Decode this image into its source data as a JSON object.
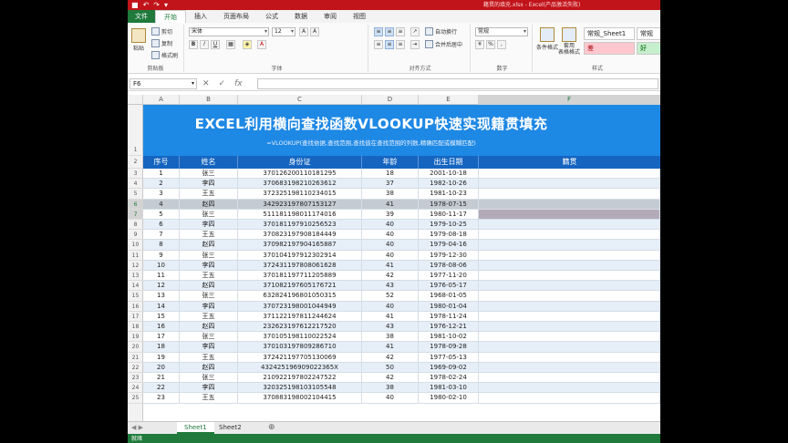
{
  "titlebar": {
    "title": "籍贯的填充.xlsx - Excel(产品激活失败)",
    "qat": [
      "■",
      "↶",
      "↷",
      "▾"
    ]
  },
  "tabs": [
    "文件",
    "开始",
    "插入",
    "页面布局",
    "公式",
    "数据",
    "审阅",
    "视图"
  ],
  "ribbon": {
    "clipboard": {
      "paste": "粘贴",
      "cut": "剪切",
      "copy": "复制",
      "format_painter": "格式刷",
      "label": "剪贴板"
    },
    "font": {
      "name": "宋体",
      "size": "12",
      "bold": "B",
      "italic": "I",
      "underline": "U",
      "grow": "A",
      "shrink": "A",
      "color": "A",
      "label": "字体"
    },
    "alignment": {
      "wrap": "自动换行",
      "merge": "合并后居中",
      "label": "对齐方式"
    },
    "number": {
      "format": "常规",
      "percent": "%",
      "comma": ",",
      "label": "数字"
    },
    "styles": {
      "conditional": "条件格式",
      "table": "套用\n表格格式",
      "style_normal_sheet": "常规_Sheet1",
      "style_normal": "常规",
      "style_bad": "差",
      "style_good": "好",
      "label": "样式"
    }
  },
  "formula_bar": {
    "namebox": "F6",
    "cancel": "✕",
    "enter": "✓",
    "fx": "fx"
  },
  "columns": [
    "A",
    "B",
    "C",
    "D",
    "E",
    "F"
  ],
  "banner": {
    "title": "EXCEL利用横向查找函数VLOOKUP快速实现籍贯填充",
    "subtitle": "=VLOOKUP(查找依据,查找范围,查找值在查找范围的列数,精确匹配或模糊匹配)"
  },
  "table": {
    "headers": [
      "序号",
      "姓名",
      "身份证",
      "年龄",
      "出生日期",
      "籍贯"
    ],
    "rows": [
      [
        "1",
        "张三",
        "370126200110181295",
        "18",
        "2001-10-18"
      ],
      [
        "2",
        "李四",
        "370683198210263612",
        "37",
        "1982-10-26"
      ],
      [
        "3",
        "王五",
        "372325198110234015",
        "38",
        "1981-10-23"
      ],
      [
        "4",
        "赵四",
        "342923197807153127",
        "41",
        "1978-07-15"
      ],
      [
        "5",
        "张三",
        "511181198011174016",
        "39",
        "1980-11-17"
      ],
      [
        "6",
        "李四",
        "370181197910256523",
        "40",
        "1979-10-25"
      ],
      [
        "7",
        "王五",
        "370823197908184449",
        "40",
        "1979-08-18"
      ],
      [
        "8",
        "赵四",
        "370982197904165887",
        "40",
        "1979-04-16"
      ],
      [
        "9",
        "张三",
        "370104197912302914",
        "40",
        "1979-12-30"
      ],
      [
        "10",
        "李四",
        "372431197808061628",
        "41",
        "1978-08-06"
      ],
      [
        "11",
        "王五",
        "370181197711205889",
        "42",
        "1977-11-20"
      ],
      [
        "12",
        "赵四",
        "371082197605176721",
        "43",
        "1976-05-17"
      ],
      [
        "13",
        "张三",
        "632824196801050315",
        "52",
        "1968-01-05"
      ],
      [
        "14",
        "李四",
        "370723198001044949",
        "40",
        "1980-01-04"
      ],
      [
        "15",
        "王五",
        "371122197811244624",
        "41",
        "1978-11-24"
      ],
      [
        "16",
        "赵四",
        "232623197612217520",
        "43",
        "1976-12-21"
      ],
      [
        "17",
        "张三",
        "370105198110022524",
        "38",
        "1981-10-02"
      ],
      [
        "18",
        "李四",
        "370103197809286710",
        "41",
        "1978-09-28"
      ],
      [
        "19",
        "王五",
        "372421197705130069",
        "42",
        "1977-05-13"
      ],
      [
        "20",
        "赵四",
        "432425196909022365X",
        "50",
        "1969-09-02"
      ],
      [
        "21",
        "张三",
        "210922197802247522",
        "42",
        "1978-02-24"
      ],
      [
        "22",
        "李四",
        "320325198103105548",
        "38",
        "1981-03-10"
      ],
      [
        "23",
        "王五",
        "370883198002104415",
        "40",
        "1980-02-10"
      ]
    ]
  },
  "row_numbers": [
    "1",
    "2",
    "3",
    "4",
    "5",
    "6",
    "7",
    "8",
    "9",
    "10",
    "11",
    "12",
    "13",
    "14",
    "15",
    "16",
    "17",
    "18",
    "19",
    "20",
    "21",
    "22",
    "23",
    "24",
    "25"
  ],
  "sheets": [
    "Sheet1",
    "Sheet2"
  ],
  "sheet_add": "⊕",
  "sheet_nav": "◀ ▶",
  "status": "就绪"
}
